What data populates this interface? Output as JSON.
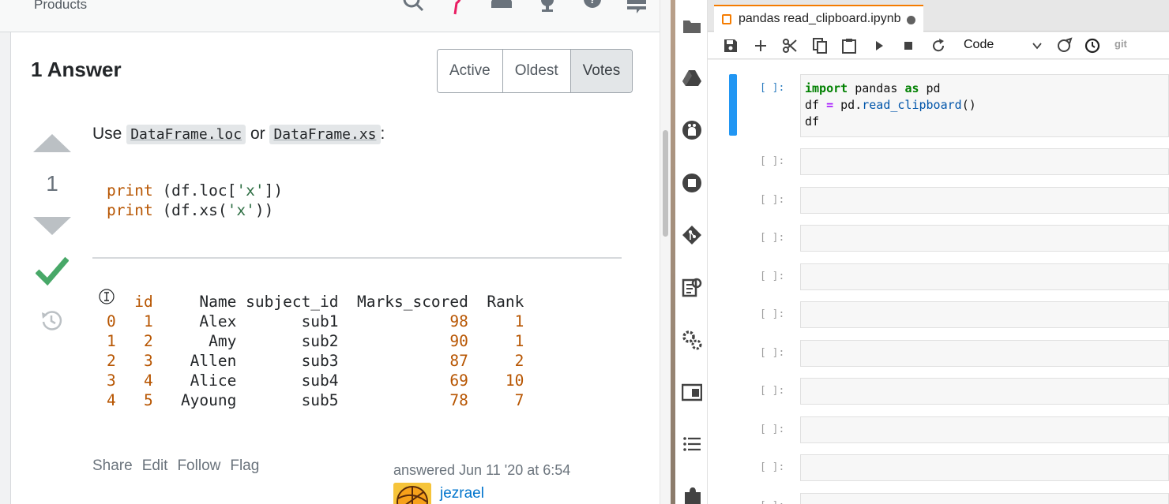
{
  "so": {
    "topbar": {
      "products_label": "Products"
    },
    "answer_header": "1 Answer",
    "sort_tabs": [
      "Active",
      "Oldest",
      "Votes"
    ],
    "vote_count": "1",
    "answer": {
      "lead": "Use",
      "code_ref_1": "DataFrame.loc",
      "conjunction": "or",
      "code_ref_2": "DataFrame.xs",
      "trailing": ":"
    },
    "code_block": {
      "line1": {
        "kw": "print",
        "pre": " (df.loc[",
        "str": "'x'",
        "post": "])"
      },
      "line2": {
        "kw": "print",
        "pre": " (df.xs(",
        "str": "'x'",
        "post": "))"
      }
    },
    "dataframe": {
      "columns": [
        "id",
        "Name",
        "subject_id",
        "Marks_scored",
        "Rank"
      ],
      "rows": [
        {
          "index": "0",
          "id": "1",
          "name": "Alex",
          "subject": "sub1",
          "marks": "98",
          "rank": "1"
        },
        {
          "index": "1",
          "id": "2",
          "name": "Amy",
          "subject": "sub2",
          "marks": "90",
          "rank": "1"
        },
        {
          "index": "2",
          "id": "3",
          "name": "Allen",
          "subject": "sub3",
          "marks": "87",
          "rank": "2"
        },
        {
          "index": "3",
          "id": "4",
          "name": "Alice",
          "subject": "sub4",
          "marks": "69",
          "rank": "10"
        },
        {
          "index": "4",
          "id": "5",
          "name": "Ayoung",
          "subject": "sub5",
          "marks": "78",
          "rank": "7"
        }
      ]
    },
    "post_menu": [
      "Share",
      "Edit",
      "Follow",
      "Flag"
    ],
    "answered_text": "answered Jun 11 '20 at 6:54",
    "user_name": "jezrael",
    "colors": {
      "accepted": "#48a868",
      "link": "#0074cc",
      "keyword": "#b75501",
      "string": "#2f6f44"
    }
  },
  "jupyter": {
    "tab_title": "pandas read_clipboard.ipynb",
    "cell_type": "Code",
    "git_label": "git",
    "first_cell": {
      "prompt": "[ ]:",
      "line1": {
        "k1": "import",
        "t1": " pandas ",
        "k2": "as",
        "t2": " pd"
      },
      "line2": {
        "t1": "df ",
        "op": "=",
        "t2": " pd.",
        "fn": "read_clipboard",
        "t3": "()"
      },
      "line3": "df"
    },
    "empty_prompt": "[ ]:",
    "colors": {
      "accent": "#2196f3",
      "tab_border": "#f57c00"
    }
  }
}
